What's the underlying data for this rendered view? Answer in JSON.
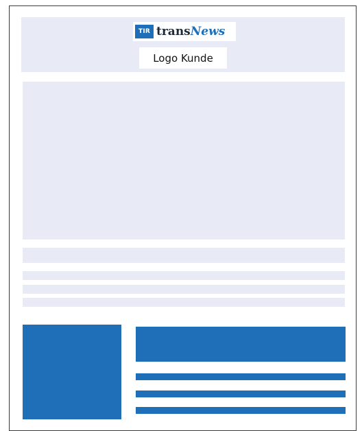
{
  "header": {
    "brand_badge": "TIR",
    "brand_trans": "trans",
    "brand_news": "News",
    "client_logo_label": "Logo Kunde"
  },
  "colors": {
    "placeholder": "#e8eaf6",
    "accent": "#1f6fb8",
    "frame_border": "#3a3a3a"
  }
}
